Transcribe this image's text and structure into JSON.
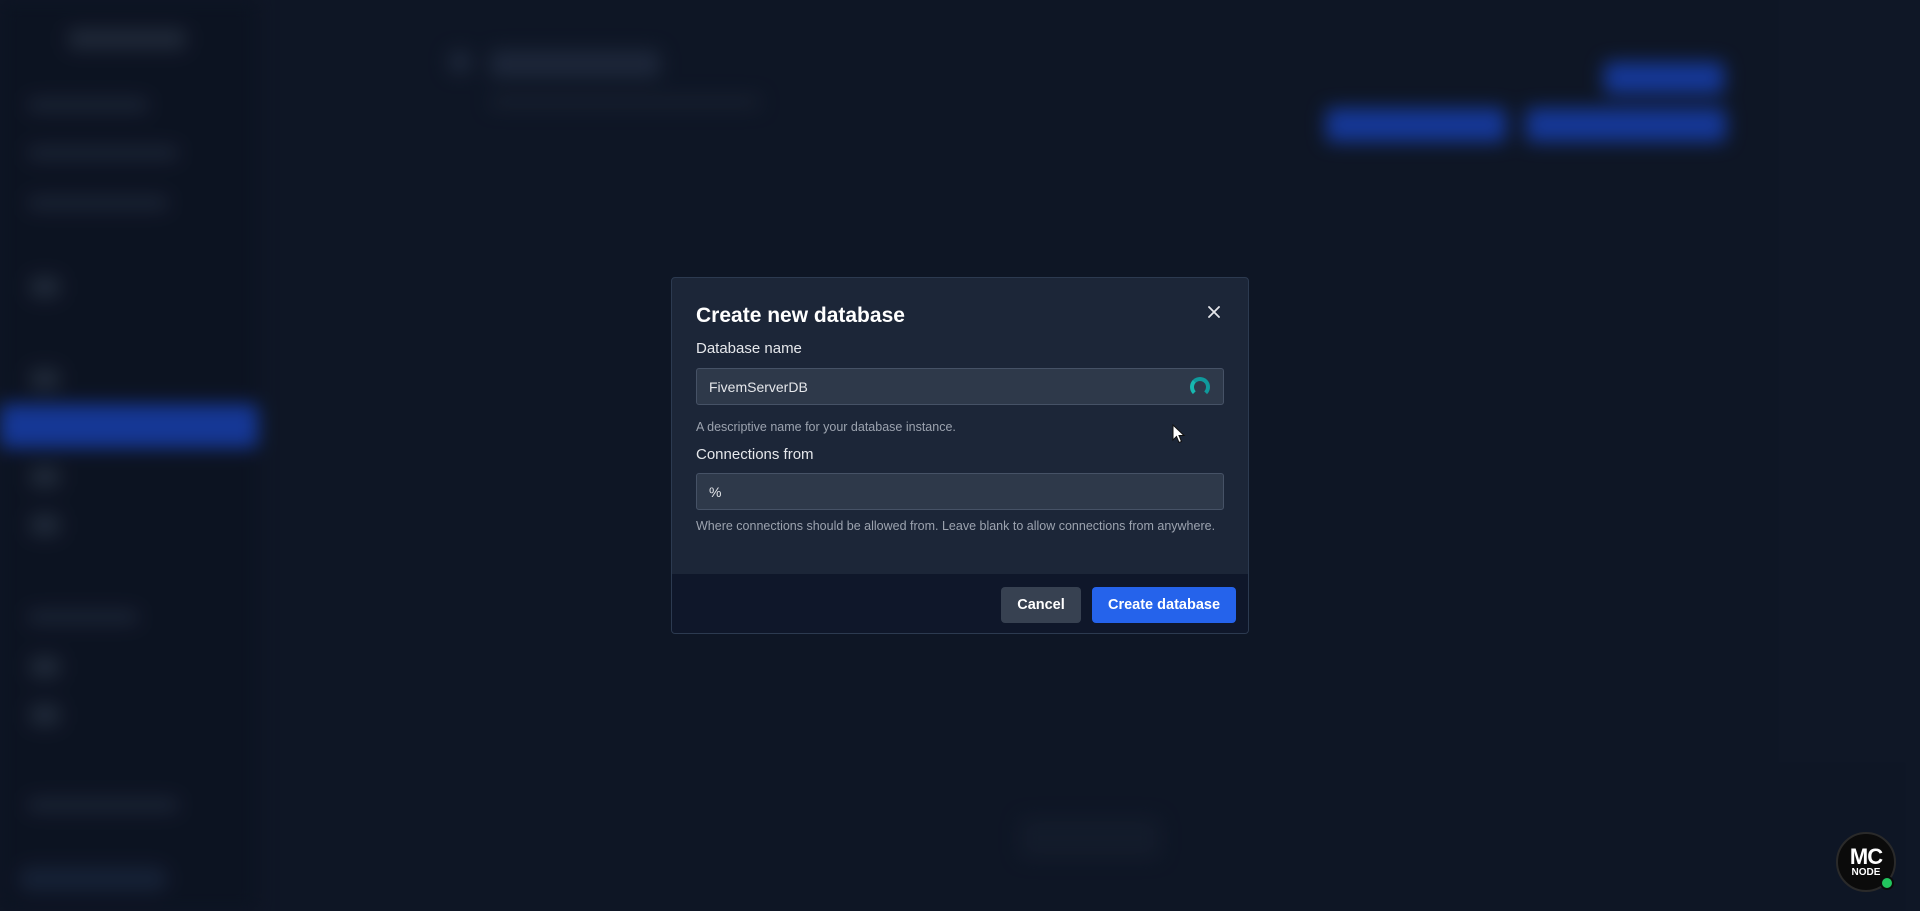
{
  "modal": {
    "title": "Create new database",
    "close_icon": "close-icon",
    "database_name": {
      "label": "Database name",
      "value": "FivemServerDB",
      "help": "A descriptive name for your database instance.",
      "status_icon": "loading-spinner-icon"
    },
    "connections_from": {
      "label": "Connections from",
      "value": "%",
      "help": "Where connections should be allowed from. Leave blank to allow connections from anywhere."
    },
    "cancel_label": "Cancel",
    "create_label": "Create database"
  },
  "badge": {
    "line1": "MC",
    "line2": "NODE",
    "status_color": "#22c55e"
  },
  "colors": {
    "accent": "#2563eb",
    "spinner": "#0f9a9c",
    "background": "#121b2c"
  }
}
